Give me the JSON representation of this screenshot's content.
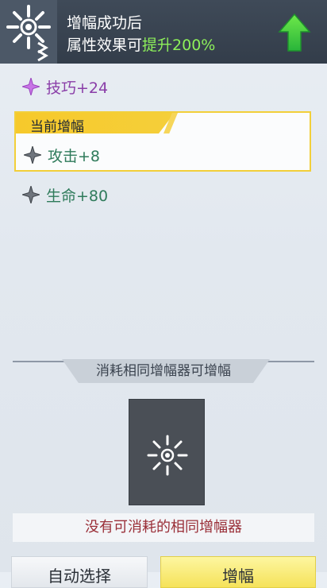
{
  "header": {
    "title": "增幅成功后",
    "subtitle_prefix": "属性效果可",
    "subtitle_highlight": "提升200%",
    "emblem_icon": "amplifier-emblem-icon",
    "arrow_icon": "up-arrow-icon"
  },
  "stats": {
    "top": {
      "label": "技巧+24",
      "icon": "purple-star-icon"
    },
    "current_label": "当前增幅",
    "current": {
      "label": "攻击+8",
      "icon": "gray-star-icon"
    },
    "next": {
      "label": "生命+80",
      "icon": "gray-star-icon"
    }
  },
  "consume": {
    "banner": "消耗相同增幅器可增幅",
    "slot_icon": "amplifier-slot-icon",
    "notice": "没有可消耗的相同增幅器"
  },
  "buttons": {
    "auto_select": "自动选择",
    "amplify": "增幅"
  },
  "colors": {
    "header_bg": "#3a4452",
    "highlight_green": "#8df05a",
    "stat_green": "#2f7b5b",
    "stat_purple": "#8a3ea8",
    "tag_yellow": "#f6c92b",
    "notice_red": "#9a2f38"
  }
}
